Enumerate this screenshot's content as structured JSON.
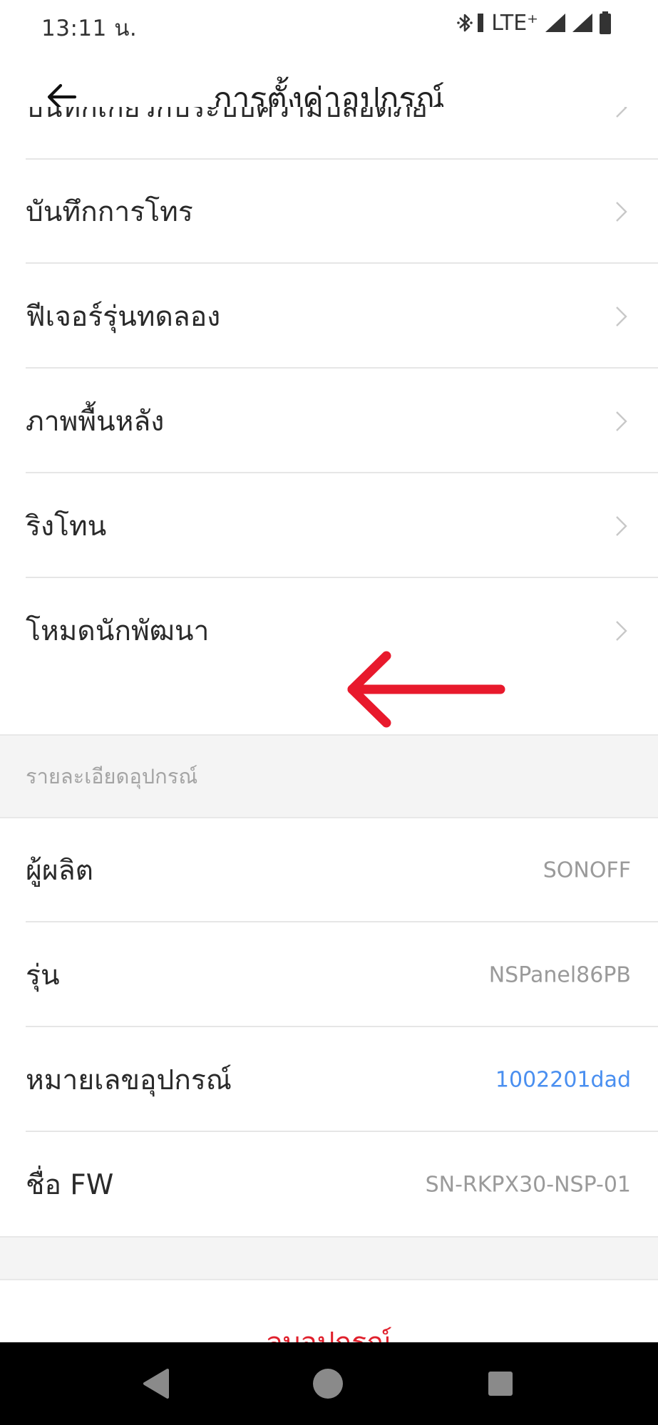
{
  "status_bar": {
    "time": "13:11 น.",
    "network": "LTE⁺",
    "icons": [
      "bluetooth-icon",
      "signal-icon",
      "battery-icon"
    ]
  },
  "app_bar": {
    "title": "การตั้งค่าอุปกรณ์",
    "back_icon": "arrow-left-icon"
  },
  "settings_rows": [
    {
      "label": "บันทึกเกี่ยวกับระบบความปลอดภัย"
    },
    {
      "label": "บันทึกการโทร"
    },
    {
      "label": "ฟีเจอร์รุ่นทดลอง"
    },
    {
      "label": "ภาพพื้นหลัง"
    },
    {
      "label": "ริงโทน"
    },
    {
      "label": "โหมดนักพัฒนา"
    }
  ],
  "device_info": {
    "header": "รายละเอียดอุปกรณ์",
    "rows": [
      {
        "label": "ผู้ผลิต",
        "value": "SONOFF"
      },
      {
        "label": "รุ่น",
        "value": "NSPanel86PB"
      },
      {
        "label": "หมายเลขอุปกรณ์",
        "value": "1002201dad"
      },
      {
        "label": "ชื่อ FW",
        "value": "SN-RKPX30-NSP-01"
      }
    ]
  },
  "delete_button": {
    "label": "ลบอุปกรณ์"
  },
  "colors": {
    "accent_link": "#4a8ff0",
    "danger": "#e0202c",
    "annotation_arrow": "#e8192c",
    "section_bg": "#f4f4f4"
  },
  "nav_bar": {
    "icons": [
      "nav-back-icon",
      "nav-home-icon",
      "nav-recents-icon"
    ]
  }
}
